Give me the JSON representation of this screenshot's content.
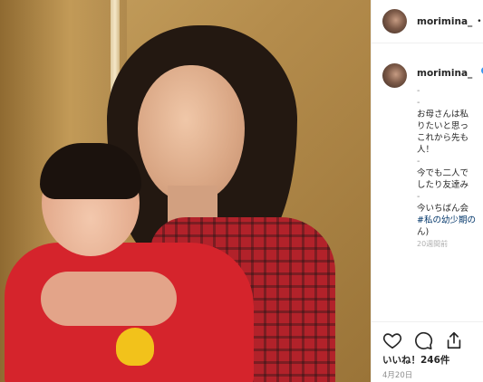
{
  "header": {
    "username": "morimina_",
    "separator": "•"
  },
  "caption": {
    "username": "morimina_",
    "lines": [
      "-",
      "-",
      "お母さんは私",
      "りたいと思っ",
      "これから先も",
      "人！",
      "-",
      "今でも二人で",
      "したり友達み",
      "-",
      "今いちばん会",
      "#私の幼少期の",
      "ん)",
      "20週間前"
    ]
  },
  "actions": {
    "likes": "いいね！246件",
    "date": "4月20日",
    "icons": [
      "heart-icon",
      "comment-icon",
      "share-icon"
    ]
  },
  "colors": {
    "accent": "#3897f0",
    "hashtag": "#003569",
    "muted": "#8e8e8e"
  }
}
